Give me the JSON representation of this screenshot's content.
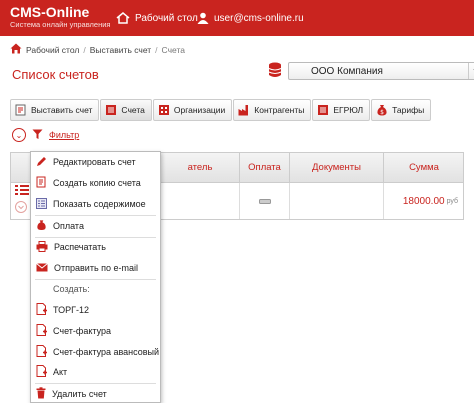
{
  "header": {
    "brand_name": "CMS-Online",
    "brand_sub": "Система онлайн управления",
    "desktop_label": "Рабочий стол",
    "user_label": "user@cms-online.ru"
  },
  "breadcrumb": {
    "home": "Рабочий стол",
    "issue": "Выставить счет",
    "current": "Счета"
  },
  "page": {
    "title": "Список счетов"
  },
  "company": {
    "selected": "ООО Компания"
  },
  "tabs": [
    {
      "label": "Выставить счет",
      "icon": "invoice-new-icon"
    },
    {
      "label": "Счета",
      "icon": "invoices-icon"
    },
    {
      "label": "Организации",
      "icon": "building-icon"
    },
    {
      "label": "Контрагенты",
      "icon": "factory-icon"
    },
    {
      "label": "ЕГРЮЛ",
      "icon": "register-icon"
    },
    {
      "label": "Тарифы",
      "icon": "money-bag-icon"
    }
  ],
  "filter": {
    "label": "Фильтр"
  },
  "table": {
    "headers": {
      "payer": "Плательщик",
      "payer_visible": "атель",
      "payment": "Оплата",
      "documents": "Документы",
      "sum": "Сумма"
    },
    "rows": [
      {
        "sum": "18000.00",
        "currency": "руб"
      }
    ]
  },
  "menu": {
    "items": {
      "edit": "Редактировать счет",
      "copy": "Создать копию счета",
      "show": "Показать содержимое",
      "payment": "Оплата",
      "print": "Распечатать",
      "email": "Отправить по e-mail",
      "create_head": "Создать:",
      "torg": "ТОРГ-12",
      "invoice": "Счет-фактура",
      "advance": "Счет-фактура авансовый",
      "act": "Акт",
      "delete": "Удалить счет"
    }
  },
  "colors": {
    "brand": "#c9241f",
    "header_bg": "#c9241f"
  }
}
